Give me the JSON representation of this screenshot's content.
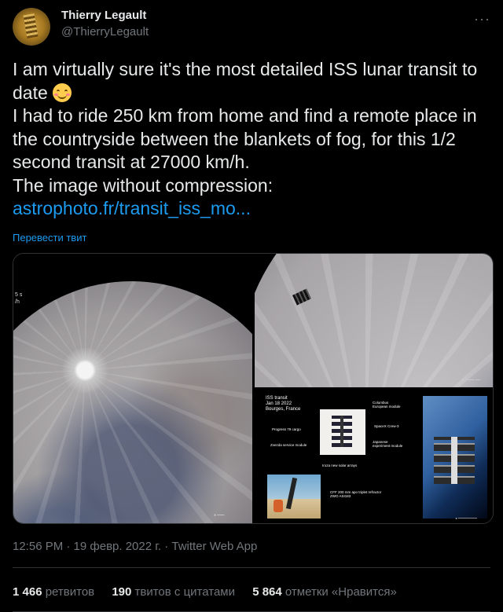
{
  "author": {
    "display_name": "Thierry Legault",
    "handle": "@ThierryLegault"
  },
  "tweet": {
    "line1": "I am virtually sure it's the most detailed ISS lunar transit to date ",
    "line2": "I had to ride 250 km from home and find a remote place in the countryside between the blankets of fog, for this 1/2 second transit at 27000 km/h.",
    "line3": "The image without compression:",
    "link": "astrophoto.fr/transit_iss_mo..."
  },
  "translate_label": "Перевести твит",
  "media": {
    "img1_edge_text": "5 s\n/h",
    "img3": {
      "title": "ISS transit\nJan 18 2022\nBourges, France",
      "labels": {
        "columbus": "Columbus\nEuropean module",
        "progress": "Progress 79 cargo",
        "spacex": "SpaceX Crew-3",
        "zvezda": "Zvezda service module",
        "japanese": "Japanese\nexperiment module",
        "solar": "Iroza new solar arrays",
        "telescope": "CFF 200 mm apo triplet refractor\nZWO ASI183"
      }
    }
  },
  "meta": "12:56 PM · 19 февр. 2022 г. · Twitter Web App",
  "stats": {
    "retweets_count": "1 466",
    "retweets_label": "ретвитов",
    "quotes_count": "190",
    "quotes_label": "твитов с цитатами",
    "likes_count": "5 864",
    "likes_label": "отметки «Нравится»"
  }
}
